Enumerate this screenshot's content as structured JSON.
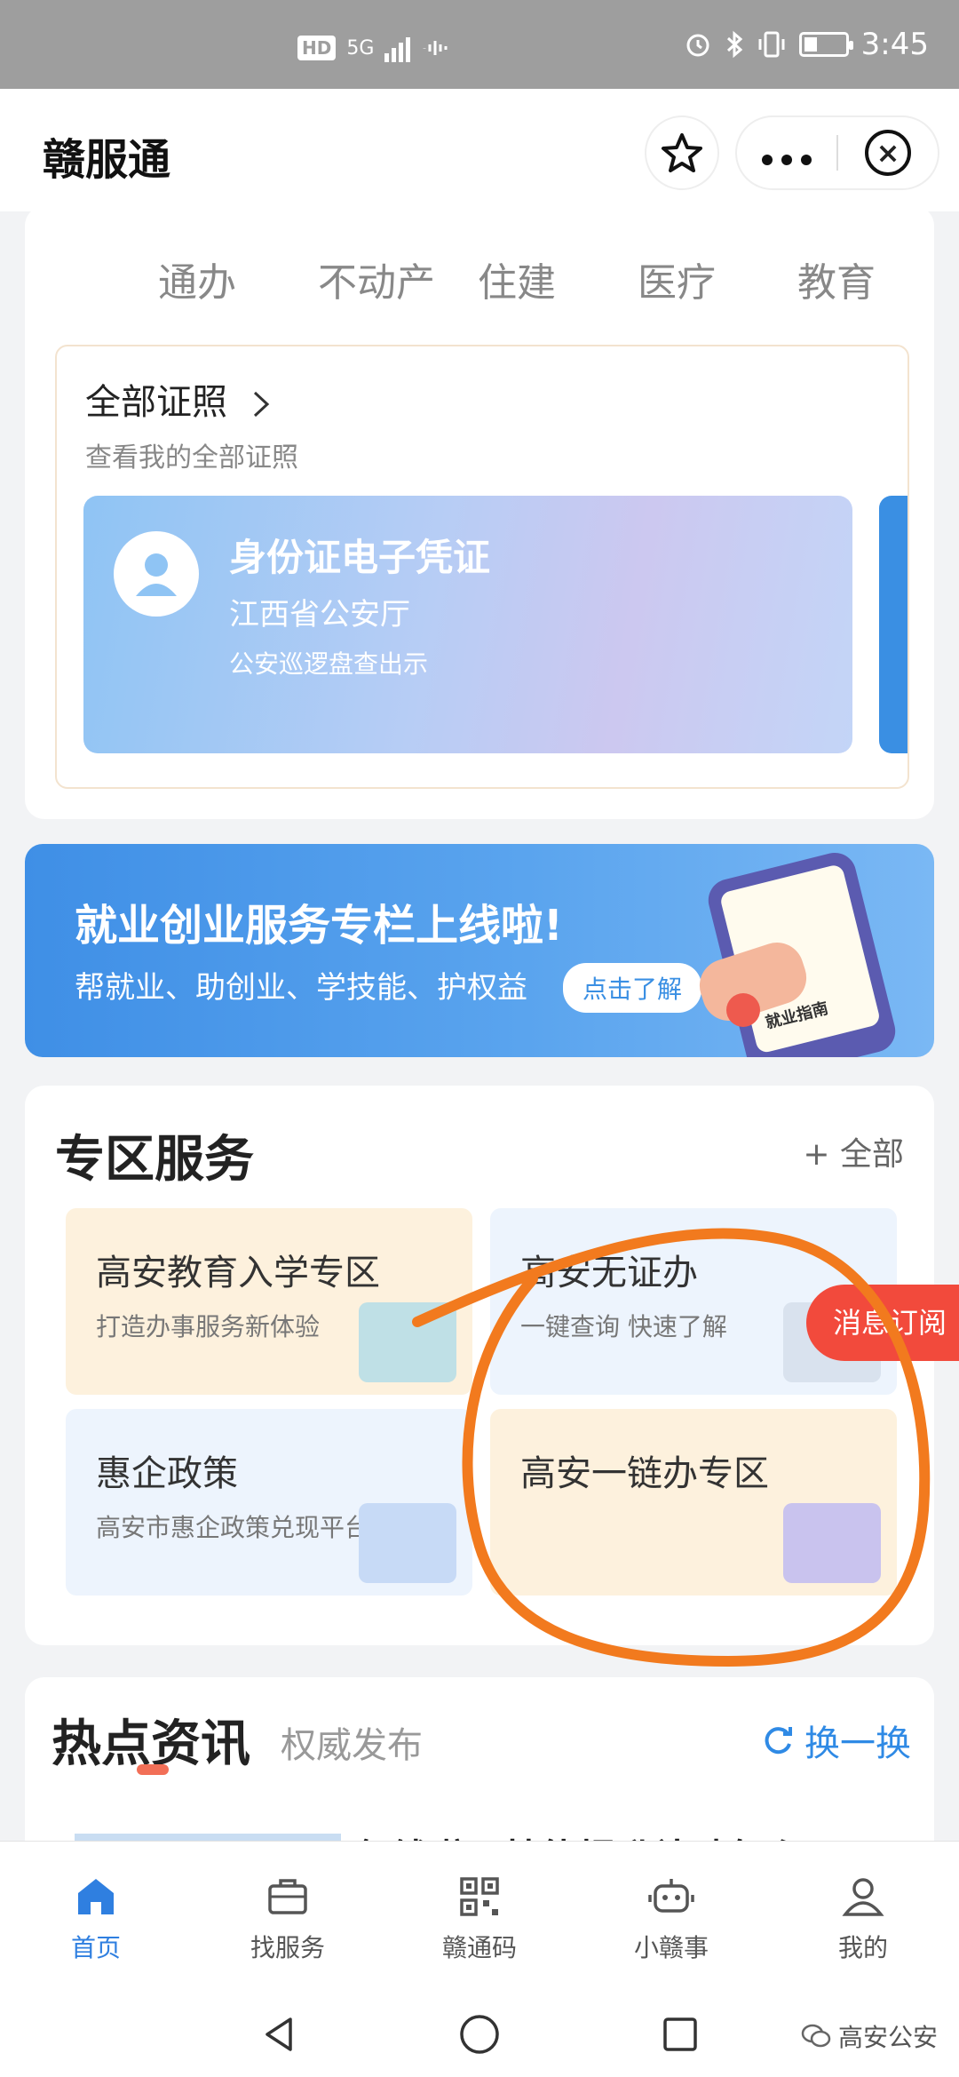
{
  "status_bar": {
    "hd": "HD",
    "network": "5G",
    "time": "3:45"
  },
  "title_bar": {
    "title": "赣服通"
  },
  "categories": [
    "通办",
    "不动产",
    "住建",
    "医疗",
    "教育"
  ],
  "certificates": {
    "title": "全部证照",
    "subtitle": "查看我的全部证照",
    "id_card": {
      "name": "身份证电子凭证",
      "issuer": "江西省公安厅",
      "hint": "公安巡逻盘查出示"
    }
  },
  "banner": {
    "title": "就业创业服务专栏上线啦!",
    "subtitle": "帮就业、助创业、学技能、护权益",
    "button": "点击了解",
    "phone_label": "就业指南"
  },
  "zone": {
    "title": "专区服务",
    "all_label": "+ 全部",
    "tiles": [
      {
        "title": "高安教育入学专区",
        "subtitle": "打造办事服务新体验"
      },
      {
        "title": "高安无证办",
        "subtitle": "一键查询 快速了解"
      },
      {
        "title": "惠企政策",
        "subtitle": "高安市惠企政策兑现平台"
      },
      {
        "title": "高安一链办专区",
        "subtitle": ""
      }
    ]
  },
  "message_pill": "消息订阅",
  "news": {
    "title": "热点资讯",
    "subtitle": "权威发布",
    "refresh": "换一换",
    "first_headline": "领钱啦！技能提升补贴怎么"
  },
  "tabbar": [
    {
      "label": "首页",
      "icon": "home-icon"
    },
    {
      "label": "找服务",
      "icon": "briefcase-icon"
    },
    {
      "label": "赣通码",
      "icon": "qr-code-icon"
    },
    {
      "label": "小赣事",
      "icon": "robot-icon"
    },
    {
      "label": "我的",
      "icon": "user-icon"
    }
  ],
  "watermark": "高安公安",
  "colors": {
    "accent": "#2f7fe0",
    "alert": "#f24a3c",
    "annotation": "#f27a1e"
  }
}
